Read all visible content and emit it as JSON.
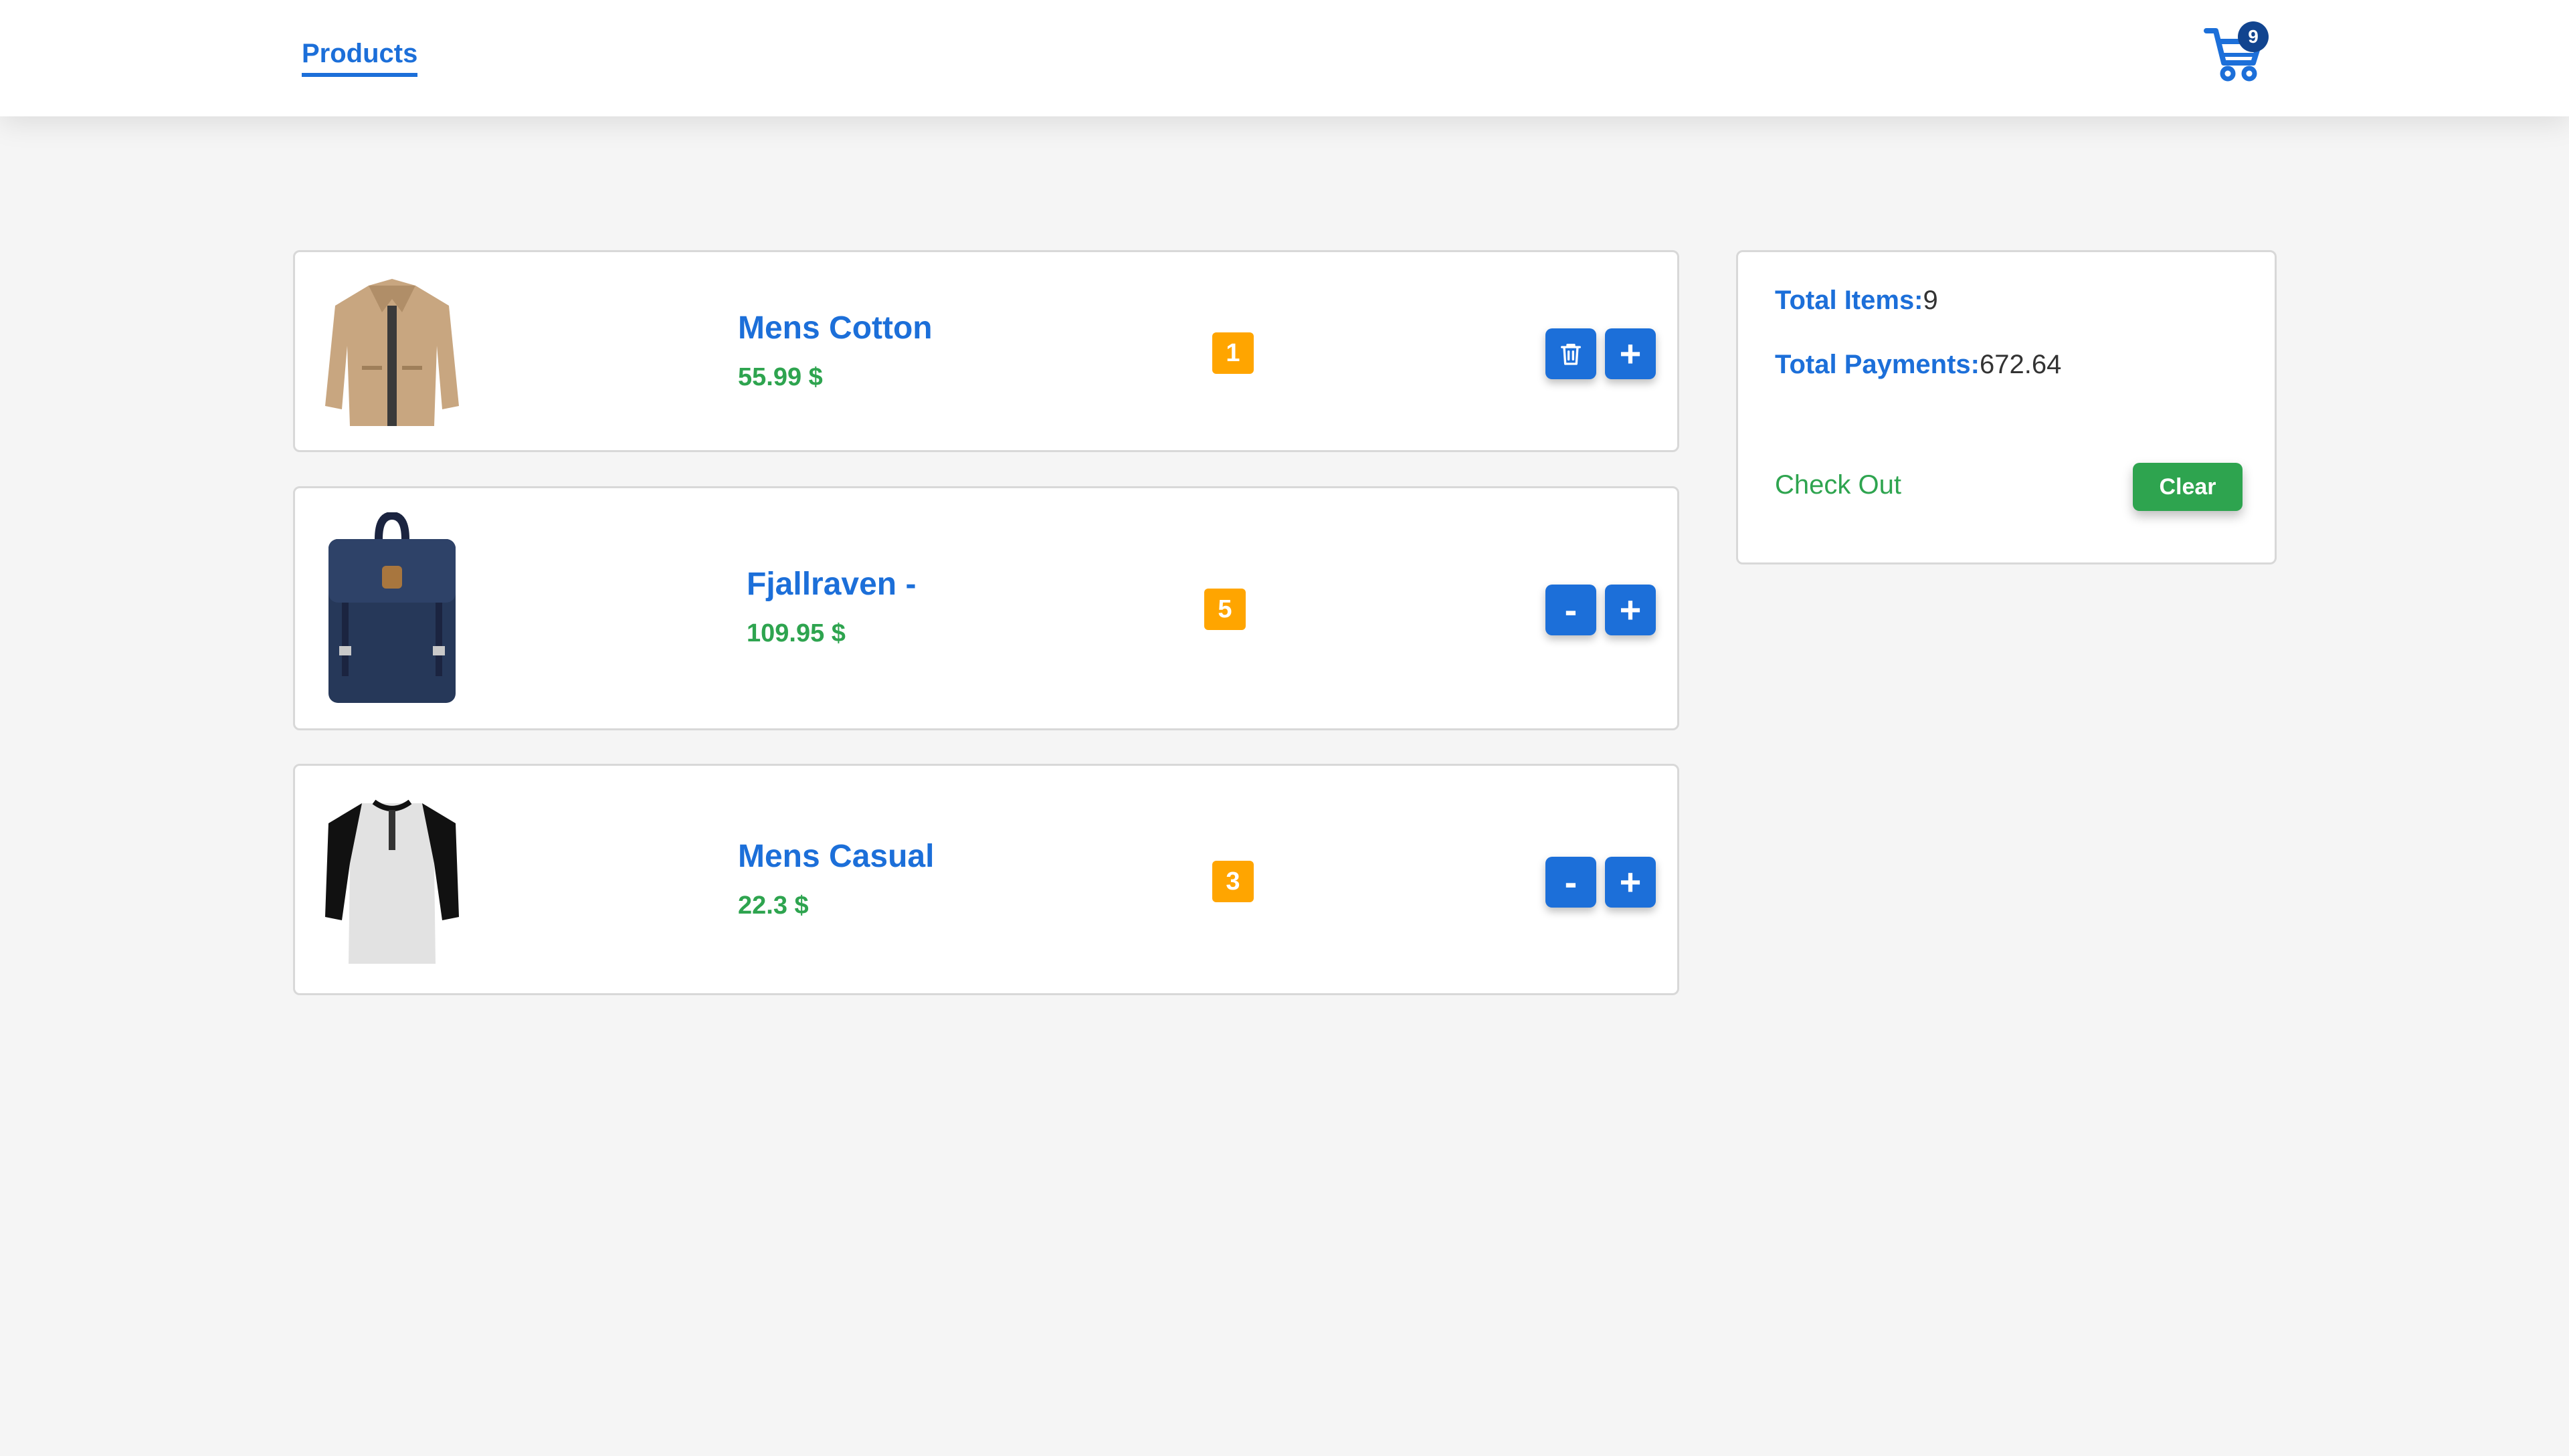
{
  "navbar": {
    "products_link": "Products",
    "cart_count": "9"
  },
  "cart": {
    "items": [
      {
        "name": "Mens Cotton",
        "price": "55.99 $",
        "quantity": "1",
        "decrease_action": "trash-icon",
        "increase_label": "+"
      },
      {
        "name": "Fjallraven -",
        "price": "109.95 $",
        "quantity": "5",
        "decrease_label": "-",
        "increase_label": "+"
      },
      {
        "name": "Mens Casual",
        "price": "22.3 $",
        "quantity": "3",
        "decrease_label": "-",
        "increase_label": "+"
      }
    ]
  },
  "summary": {
    "total_items_label": "Total Items:",
    "total_items_value": "9",
    "total_payments_label": "Total Payments:",
    "total_payments_value": "672.64",
    "checkout_label": "Check Out",
    "clear_label": "Clear"
  },
  "colors": {
    "primary": "#1c6fd9",
    "price_green": "#2ea44f",
    "quantity_orange": "#ffa500",
    "badge_dark_blue": "#11448f",
    "background": "#f5f5f5"
  }
}
